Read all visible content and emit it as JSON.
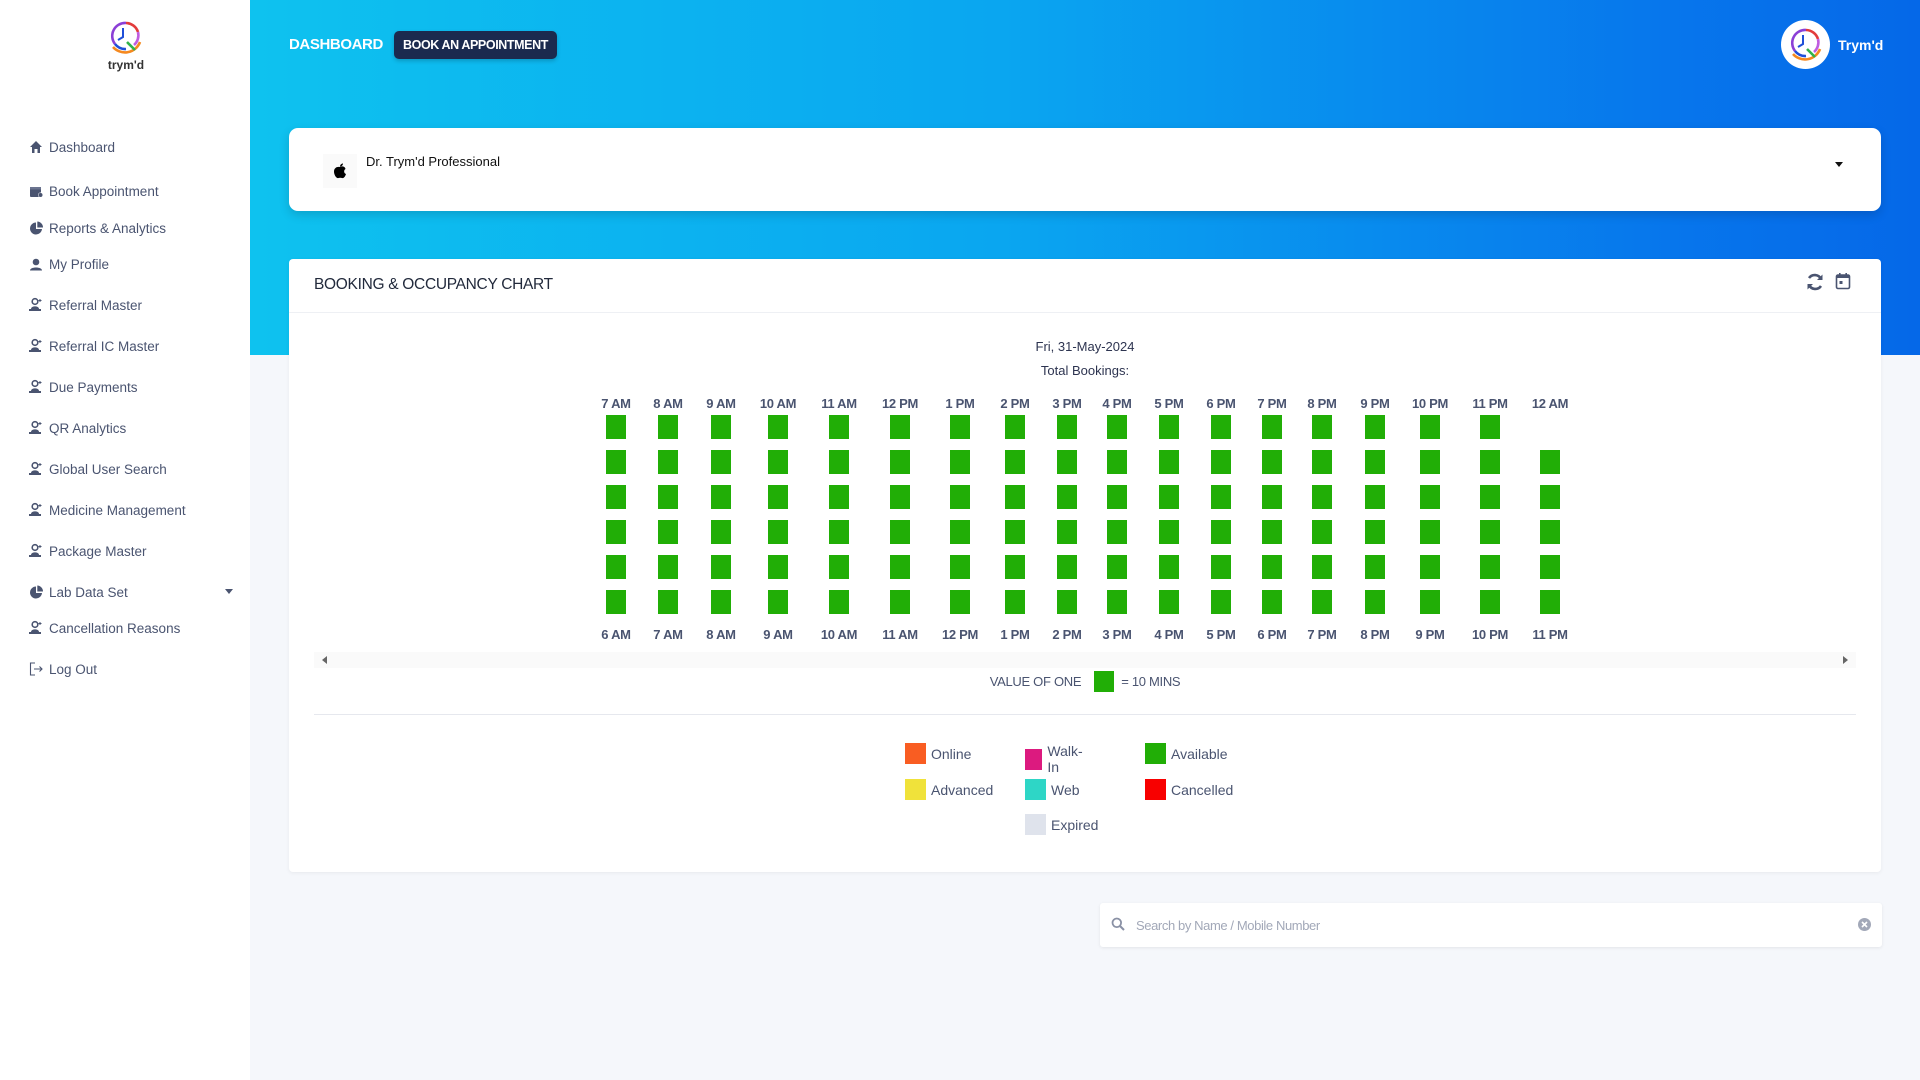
{
  "brand": {
    "logo_text": "trym'd"
  },
  "sidebar": {
    "items": [
      {
        "label": "Dashboard",
        "icon": "home-icon"
      },
      {
        "label": "Book Appointment",
        "icon": "calendar-clock-icon"
      },
      {
        "label": "Reports & Analytics",
        "icon": "pie-chart-icon"
      },
      {
        "label": "My Profile",
        "icon": "user-icon"
      },
      {
        "label": "Referral Master",
        "icon": "user-desk-icon"
      },
      {
        "label": "Referral IC Master",
        "icon": "user-desk-icon"
      },
      {
        "label": "Due Payments",
        "icon": "user-desk-icon"
      },
      {
        "label": "QR Analytics",
        "icon": "user-desk-icon"
      },
      {
        "label": "Global User Search",
        "icon": "user-desk-icon"
      },
      {
        "label": "Medicine Management",
        "icon": "user-desk-icon"
      },
      {
        "label": "Package Master",
        "icon": "user-desk-icon"
      },
      {
        "label": "Lab Data Set",
        "icon": "pie-chart-icon",
        "has_dropdown": true
      },
      {
        "label": "Cancellation Reasons",
        "icon": "user-desk-icon"
      },
      {
        "label": "Log Out",
        "icon": "logout-icon"
      }
    ]
  },
  "header": {
    "breadcrumb": "DASHBOARD",
    "book_button": "BOOK AN APPOINTMENT",
    "user_name": "Trym'd"
  },
  "doctor_select": {
    "selected": "Dr. Trym'd Professional",
    "icon": "apple-icon"
  },
  "chart_card": {
    "title": "BOOKING & OCCUPANCY CHART",
    "date": "Fri, 31-May-2024",
    "total_bookings": "Total Bookings:",
    "value_note_prefix": "VALUE OF ONE",
    "value_note_suffix": "= 10 MINS",
    "icons": [
      "refresh-icon",
      "calendar-icon"
    ]
  },
  "chart_data": {
    "type": "heatmap",
    "title": "BOOKING & OCCUPANCY CHART",
    "subtitle": "Fri, 31-May-2024",
    "top_labels": [
      "7 AM",
      "8 AM",
      "9 AM",
      "10 AM",
      "11 AM",
      "12 PM",
      "1 PM",
      "2 PM",
      "3 PM",
      "4 PM",
      "5 PM",
      "6 PM",
      "7 PM",
      "8 PM",
      "9 PM",
      "10 PM",
      "11 PM",
      "12 AM"
    ],
    "bottom_labels": [
      "6 AM",
      "7 AM",
      "8 AM",
      "9 AM",
      "10 AM",
      "11 AM",
      "12 PM",
      "1 PM",
      "2 PM",
      "3 PM",
      "4 PM",
      "5 PM",
      "6 PM",
      "7 PM",
      "8 PM",
      "9 PM",
      "10 PM",
      "11 PM"
    ],
    "slot_minutes": 10,
    "slots_per_hour": 6,
    "slot_status": [
      [
        "Available",
        "Available",
        "Available",
        "Available",
        "Available",
        "Available"
      ],
      [
        "Available",
        "Available",
        "Available",
        "Available",
        "Available",
        "Available"
      ],
      [
        "Available",
        "Available",
        "Available",
        "Available",
        "Available",
        "Available"
      ],
      [
        "Available",
        "Available",
        "Available",
        "Available",
        "Available",
        "Available"
      ],
      [
        "Available",
        "Available",
        "Available",
        "Available",
        "Available",
        "Available"
      ],
      [
        "Available",
        "Available",
        "Available",
        "Available",
        "Available",
        "Available"
      ],
      [
        "Available",
        "Available",
        "Available",
        "Available",
        "Available",
        "Available"
      ],
      [
        "Available",
        "Available",
        "Available",
        "Available",
        "Available",
        "Available"
      ],
      [
        "Available",
        "Available",
        "Available",
        "Available",
        "Available",
        "Available"
      ],
      [
        "Available",
        "Available",
        "Available",
        "Available",
        "Available",
        "Available"
      ],
      [
        "Available",
        "Available",
        "Available",
        "Available",
        "Available",
        "Available"
      ],
      [
        "Available",
        "Available",
        "Available",
        "Available",
        "Available",
        "Available"
      ],
      [
        "Available",
        "Available",
        "Available",
        "Available",
        "Available",
        "Available"
      ],
      [
        "Available",
        "Available",
        "Available",
        "Available",
        "Available",
        "Available"
      ],
      [
        "Available",
        "Available",
        "Available",
        "Available",
        "Available",
        "Available"
      ],
      [
        "Available",
        "Available",
        "Available",
        "Available",
        "Available",
        "Available"
      ],
      [
        "Available",
        "Available",
        "Available",
        "Available",
        "Available",
        "Available"
      ],
      [
        null,
        "Available",
        "Available",
        "Available",
        "Available",
        "Available"
      ]
    ],
    "legend": [
      {
        "label": "Online",
        "color": "#f95d22"
      },
      {
        "label": "Walk-In",
        "color": "#dc1a7f"
      },
      {
        "label": "Available",
        "color": "#21ae06"
      },
      {
        "label": "Advanced",
        "color": "#f0e23a"
      },
      {
        "label": "Web",
        "color": "#2ed6c6"
      },
      {
        "label": "Cancelled",
        "color": "#f80000"
      },
      {
        "label": "Expired",
        "color": "#dfe3ec"
      }
    ]
  },
  "search": {
    "placeholder": "Search by Name / Mobile Number",
    "value": ""
  },
  "colors": {
    "header_gradient_start": "#0ec2ef",
    "header_gradient_end": "#0568e8",
    "button_dark": "#1b2a4e",
    "available": "#21ae06"
  }
}
